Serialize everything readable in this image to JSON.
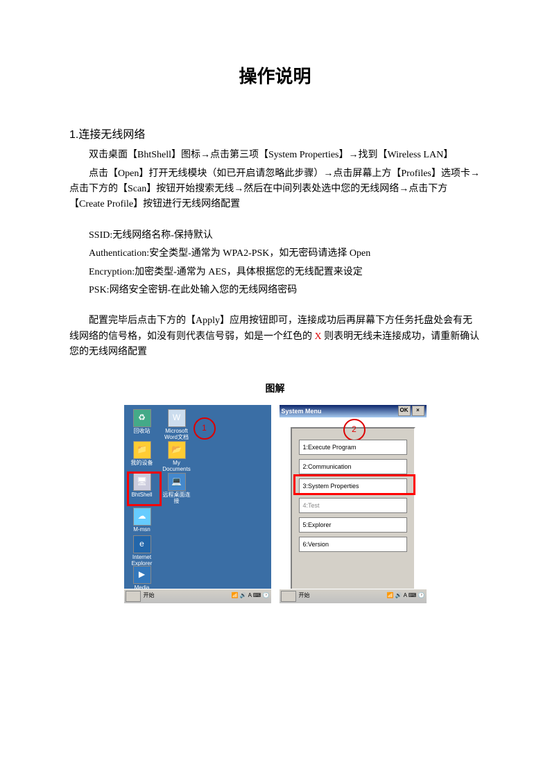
{
  "title": "操作说明",
  "section1": {
    "num": "1.",
    "heading": "连接无线网络",
    "p1": "双击桌面【BhtShell】图标→点击第三项【System Properties】→找到【Wireless LAN】",
    "p2": "点击【Open】打开无线模块（如已开启请忽略此步骤）→点击屏幕上方【Profiles】选项卡→点击下方的【Scan】按钮开始搜索无线→然后在中间列表处选中您的无线网络→点击下方【Create Profile】按钮进行无线网络配置",
    "cfg1": "SSID:无线网络名称-保持默认",
    "cfg2": "Authentication:安全类型-通常为 WPA2-PSK，如无密码请选择 Open",
    "cfg3": "Encryption:加密类型-通常为 AES，具体根据您的无线配置来设定",
    "cfg4": "PSK:网络安全密钥-在此处输入您的无线网络密码",
    "p3a": "配置完毕后点击下方的【Apply】应用按钮即可，连接成功后再屏幕下方任务托盘处会有无线网络的信号格，如没有则代表信号弱，如是一个红色的 ",
    "p3x": "X",
    "p3b": " 则表明无线未连接成功，请重新确认您的无线网络配置"
  },
  "tujie": "图解",
  "shot1": {
    "circle": "1",
    "icons": {
      "recycle": "回收站",
      "word": "Microsoft Word文档",
      "jiemao": "我的设备",
      "mydocs": "My Documents",
      "bhtshell": "BhtShell",
      "remote": "远程桌面连接",
      "msn": "M-msn",
      "ie": "Internet Explorer",
      "media": "Media Player"
    },
    "start": "开始"
  },
  "shot2": {
    "title": "System Menu",
    "ok": "OK",
    "close": "×",
    "circle": "2",
    "items": [
      "1:Execute Program",
      "2:Communication",
      "3:System Properties",
      "4:Test",
      "5:Explorer",
      "6:Version"
    ]
  }
}
